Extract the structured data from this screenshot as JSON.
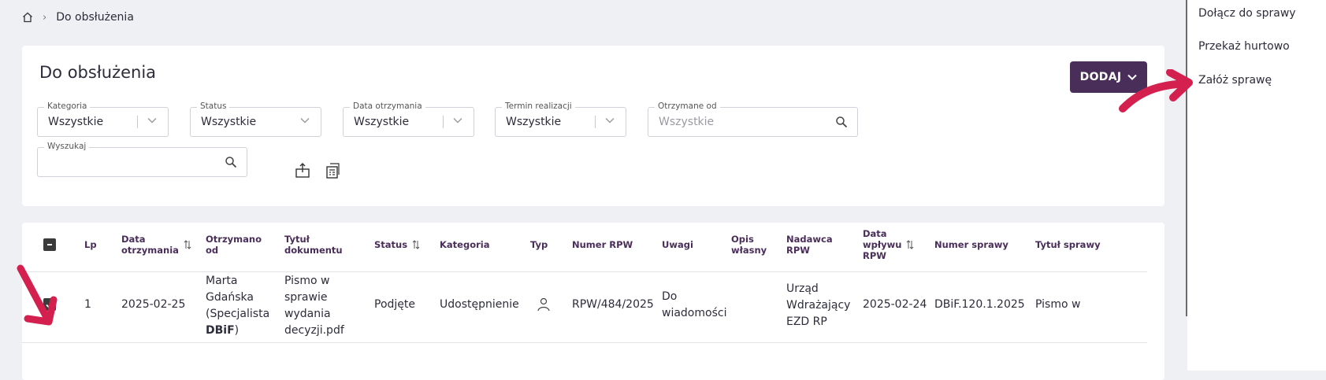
{
  "breadcrumb": {
    "current": "Do obsłużenia"
  },
  "header": {
    "title": "Do obsłużenia",
    "add_button": "DODAJ"
  },
  "filters": {
    "kategoria": {
      "label": "Kategoria",
      "value": "Wszystkie"
    },
    "status": {
      "label": "Status",
      "value": "Wszystkie"
    },
    "data_otrzymania": {
      "label": "Data otrzymania",
      "value": "Wszystkie"
    },
    "termin_realizacji": {
      "label": "Termin realizacji",
      "value": "Wszystkie"
    },
    "otrzymane_od": {
      "label": "Otrzymane od",
      "placeholder": "Wszystkie"
    },
    "wyszukaj": {
      "label": "Wyszukaj",
      "value": ""
    }
  },
  "table": {
    "columns": {
      "lp": "Lp",
      "data_otrzymania_1": "Data",
      "data_otrzymania_2": "otrzymania",
      "otrzymano_od_1": "Otrzymano",
      "otrzymano_od_2": "od",
      "tytul_1": "Tytuł",
      "tytul_2": "dokumentu",
      "status": "Status",
      "kategoria": "Kategoria",
      "typ": "Typ",
      "numer_rpw": "Numer RPW",
      "uwagi": "Uwagi",
      "opis_1": "Opis",
      "opis_2": "własny",
      "nadawca_1": "Nadawca",
      "nadawca_2": "RPW",
      "data_wplywu_1": "Data",
      "data_wplywu_2": "wpływu",
      "data_wplywu_3": "RPW",
      "numer_sprawy": "Numer sprawy",
      "tytul_sprawy": "Tytuł sprawy"
    },
    "rows": [
      {
        "lp": "1",
        "data_otrzymania": "2025-02-25",
        "otrzymano_od_1": "Marta",
        "otrzymano_od_2": "Gdańska",
        "otrzymano_od_3": "(Specjalista",
        "otrzymano_od_4_bold": "DBiF",
        "otrzymano_od_4_end": ")",
        "tytul_1": "Pismo w",
        "tytul_2": "sprawie",
        "tytul_3": "wydania",
        "tytul_4": "decyzji.pdf",
        "status": "Podjęte",
        "kategoria": "Udostępnienie",
        "numer_rpw": "RPW/484/2025",
        "uwagi_1": "Do",
        "uwagi_2": "wiadomości",
        "nadawca_1": "Urząd",
        "nadawca_2": "Wdrażający",
        "nadawca_3": "EZD RP",
        "data_wplywu": "2025-02-24",
        "numer_sprawy": "DBiF.120.1.2025",
        "tytul_sprawy": "Pismo w"
      }
    ]
  },
  "side_menu": {
    "items": [
      "Dołącz do sprawy",
      "Przekaż hurtowo",
      "Załóż sprawę"
    ]
  },
  "colors": {
    "accent": "#4a2e5a",
    "arrow": "#d4204e"
  }
}
